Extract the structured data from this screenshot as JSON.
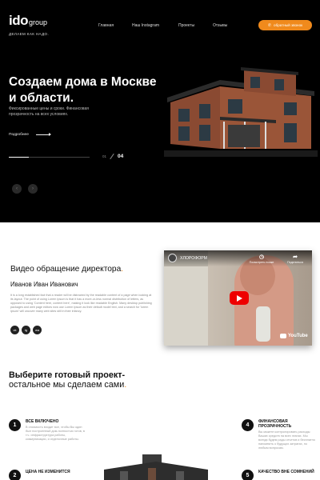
{
  "header": {
    "logo_main": "ido",
    "logo_suffix": "group",
    "logo_tagline": "ДЕЛАЕМ КАК НАДО.",
    "nav": [
      "Главная",
      "Наш Instagram",
      "Проекты",
      "Отзывы"
    ],
    "cta_label": "обратный звонок",
    "cta_icon": "phone-icon",
    "accent_color": "#f08a1c"
  },
  "hero": {
    "title": "Создаем дома в Москве и области.",
    "description": "Фиксированные цены и сроки. Финансовая прозрачность на всех условиях.",
    "more_label": "Подробнее",
    "slide_current": "01",
    "slide_total": "04",
    "slide_progress": 0.25,
    "prev_icon": "chevron-left-icon",
    "next_icon": "chevron-right-icon"
  },
  "director": {
    "title": "Видео обращение директора",
    "title_dot": ".",
    "name": "Иванов Иван Иванович",
    "text": "It is a long established fact that a reader will be distracted by the readable content of a page when looking at its layout. The point of using Lorem Ipsum is that it has a more-or-less normal distribution of letters, as opposed to using 'Content here, content here', making it look like readable English. Many desktop publishing packages and web page editors now use Lorem Ipsum as their default model text, and a search for 'lorem ipsum' will uncover many web sites still in their infancy.",
    "socials": [
      "vk-icon",
      "telegram-icon",
      "whatsapp-icon"
    ],
    "social_labels": [
      "vk",
      "tg",
      "wa"
    ],
    "video": {
      "channel": "ХЛОРОФОРМ",
      "watch_later": "Посмотреть позже",
      "share": "Поделиться",
      "platform": "YouTube"
    }
  },
  "projects": {
    "title": "Выберите готовый проект-",
    "subtitle": "остальное мы сделаем сами",
    "subtitle_dot": ".",
    "features": [
      {
        "num": "1",
        "title": "ВСЕ ВКЛЮЧЕНО",
        "text": "В стоимость входит все, чтобы Вы один был построенный дом-полностью готов, в т.ч. инфраструктура работы, коммуникации, и отделочные работы."
      },
      {
        "num": "4",
        "title": "ФИНАНСОВАЯ ПРОЗРАЧНОСТЬ",
        "text": "Вы можете контролировать расходы Ваших средств на всех этапах. Мы всегда будем рады отчетов и бесплатно напомнить о будущих затратах, по любым вопросам."
      },
      {
        "num": "2",
        "title": "ЦЕНА НЕ ИЗМЕНИТСЯ",
        "text": ""
      },
      {
        "num": "5",
        "title": "КАЧЕСТВО ВНЕ СОМНЕНИЙ",
        "text": ""
      }
    ]
  }
}
